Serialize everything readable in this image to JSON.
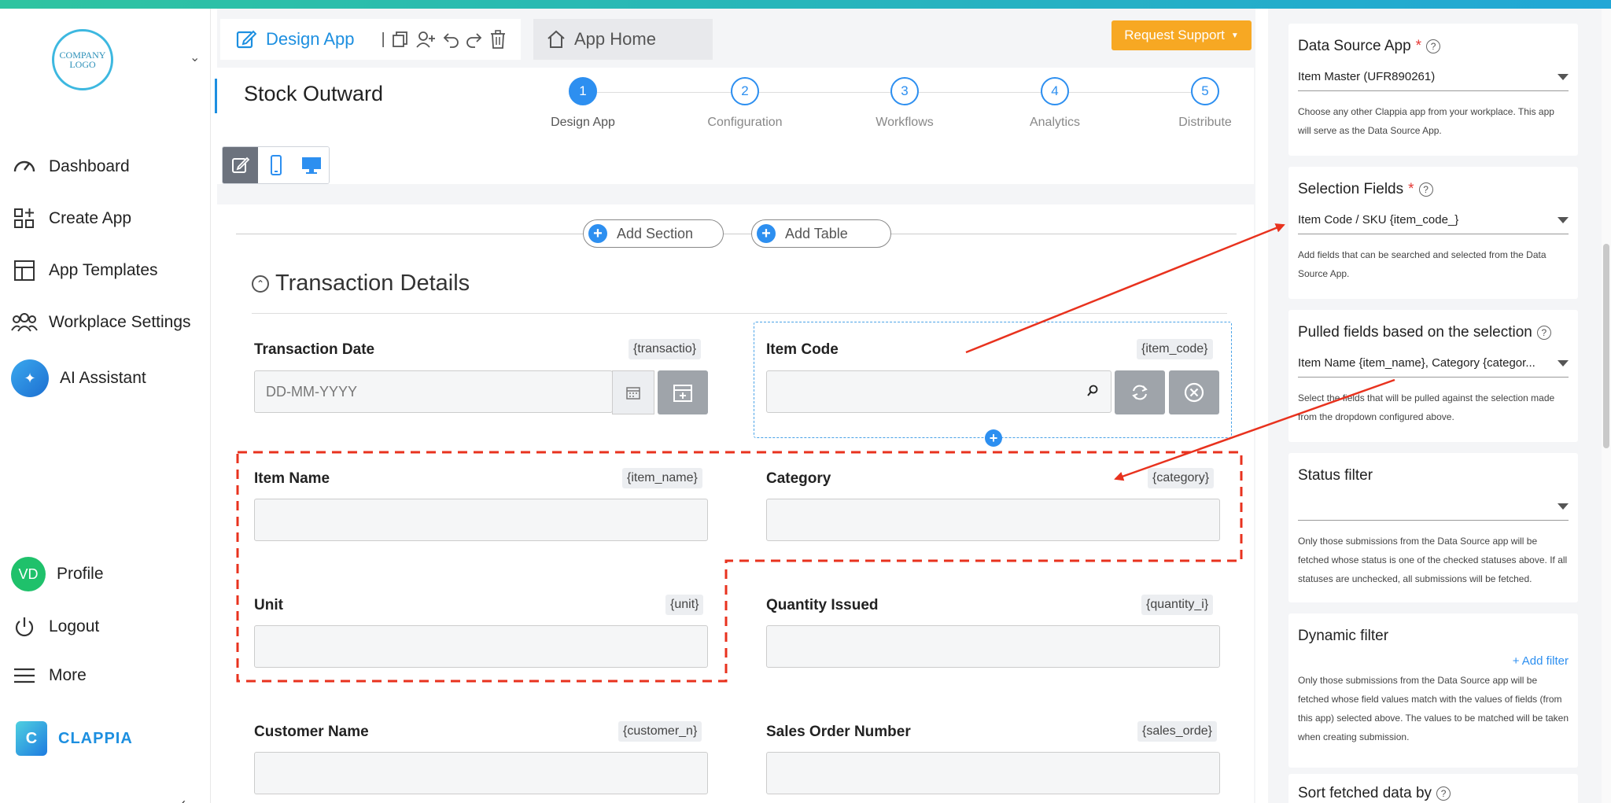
{
  "sidebar": {
    "logo_text": "COMPANY LOGO",
    "nav": [
      "Dashboard",
      "Create App",
      "App Templates",
      "Workplace Settings"
    ],
    "ai_assistant": "AI Assistant",
    "profile_initials": "VD",
    "profile": "Profile",
    "logout": "Logout",
    "more": "More",
    "brand": "CLAPPIA"
  },
  "tabs": {
    "design": "Design App",
    "home": "App Home",
    "separator": "|"
  },
  "toolbar": {
    "support": "Request Support"
  },
  "app": {
    "title": "Stock Outward"
  },
  "steps": [
    {
      "num": "1",
      "label": "Design App"
    },
    {
      "num": "2",
      "label": "Configuration"
    },
    {
      "num": "3",
      "label": "Workflows"
    },
    {
      "num": "4",
      "label": "Analytics"
    },
    {
      "num": "5",
      "label": "Distribute"
    }
  ],
  "form": {
    "add_section": "Add Section",
    "add_table": "Add Table",
    "section_title": "Transaction Details",
    "fields": {
      "transaction_date": {
        "label": "Transaction Date",
        "tag": "{transactio}",
        "placeholder": "DD-MM-YYYY"
      },
      "item_code": {
        "label": "Item Code",
        "tag": "{item_code}"
      },
      "item_name": {
        "label": "Item Name",
        "tag": "{item_name}"
      },
      "category": {
        "label": "Category",
        "tag": "{category}"
      },
      "unit": {
        "label": "Unit",
        "tag": "{unit}"
      },
      "quantity_issued": {
        "label": "Quantity Issued",
        "tag": "{quantity_i}"
      },
      "customer_name": {
        "label": "Customer Name",
        "tag": "{customer_n}"
      },
      "sales_order": {
        "label": "Sales Order Number",
        "tag": "{sales_orde}"
      }
    }
  },
  "settings": {
    "data_source": {
      "title": "Data Source App",
      "value": "Item Master (UFR890261)",
      "help": "Choose any other Clappia app from your workplace. This app will serve as the Data Source App."
    },
    "selection_fields": {
      "title": "Selection Fields",
      "value": "Item Code / SKU {item_code_}",
      "help": "Add fields that can be searched and selected from the Data Source App."
    },
    "pulled_fields": {
      "title": "Pulled fields based on the selection",
      "value": "Item Name {item_name}, Category {categor...",
      "help": "Select the fields that will be pulled against the selection made from the dropdown configured above."
    },
    "status_filter": {
      "title": "Status filter",
      "value": "",
      "help": "Only those submissions from the Data Source app will be fetched whose status is one of the checked statuses above. If all statuses are unchecked, all submissions will be fetched."
    },
    "dynamic_filter": {
      "title": "Dynamic filter",
      "add": "+ Add filter",
      "help": "Only those submissions from the Data Source app will be fetched whose field values match with the values of fields (from this app) selected above. The values to be matched will be taken when creating submission."
    },
    "sort": {
      "title": "Sort fetched data by"
    }
  },
  "colors": {
    "accent": "#2d8ff0",
    "support": "#f7a823",
    "annotation": "#e8321e"
  }
}
